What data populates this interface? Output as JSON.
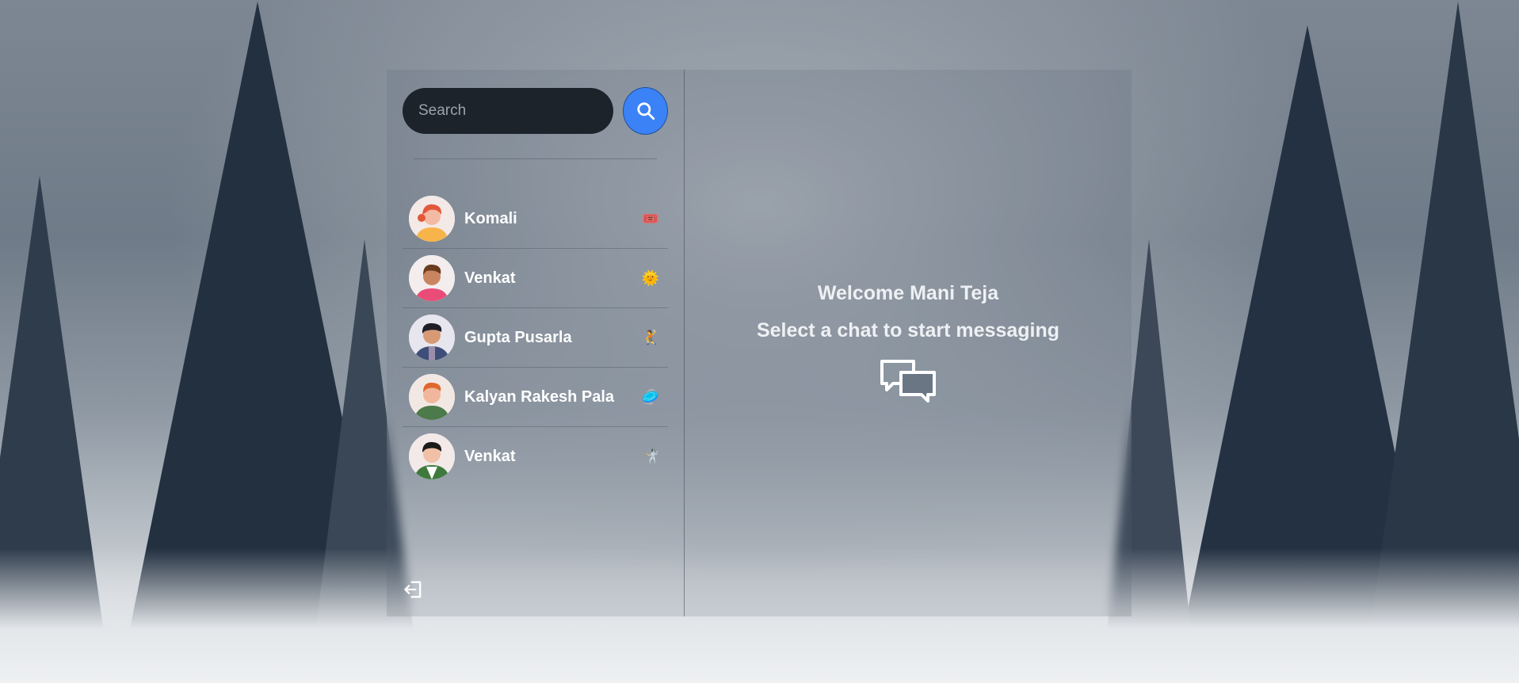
{
  "search": {
    "placeholder": "Search",
    "value": ""
  },
  "icons": {
    "search": "search-icon",
    "logout": "logout-icon",
    "messages": "chat-bubbles-icon"
  },
  "colors": {
    "accent": "#3b82f6",
    "input_bg": "#1d232b"
  },
  "chats": [
    {
      "name": "Komali",
      "emoji": "🎟️"
    },
    {
      "name": "Venkat",
      "emoji": "🌞"
    },
    {
      "name": "Gupta Pusarla",
      "emoji": "🤾"
    },
    {
      "name": "Kalyan Rakesh Pala",
      "emoji": "🥏"
    },
    {
      "name": "Venkat",
      "emoji": "🤺"
    }
  ],
  "main": {
    "welcome": "Welcome Mani Teja",
    "subtitle": "Select a chat to start messaging"
  }
}
